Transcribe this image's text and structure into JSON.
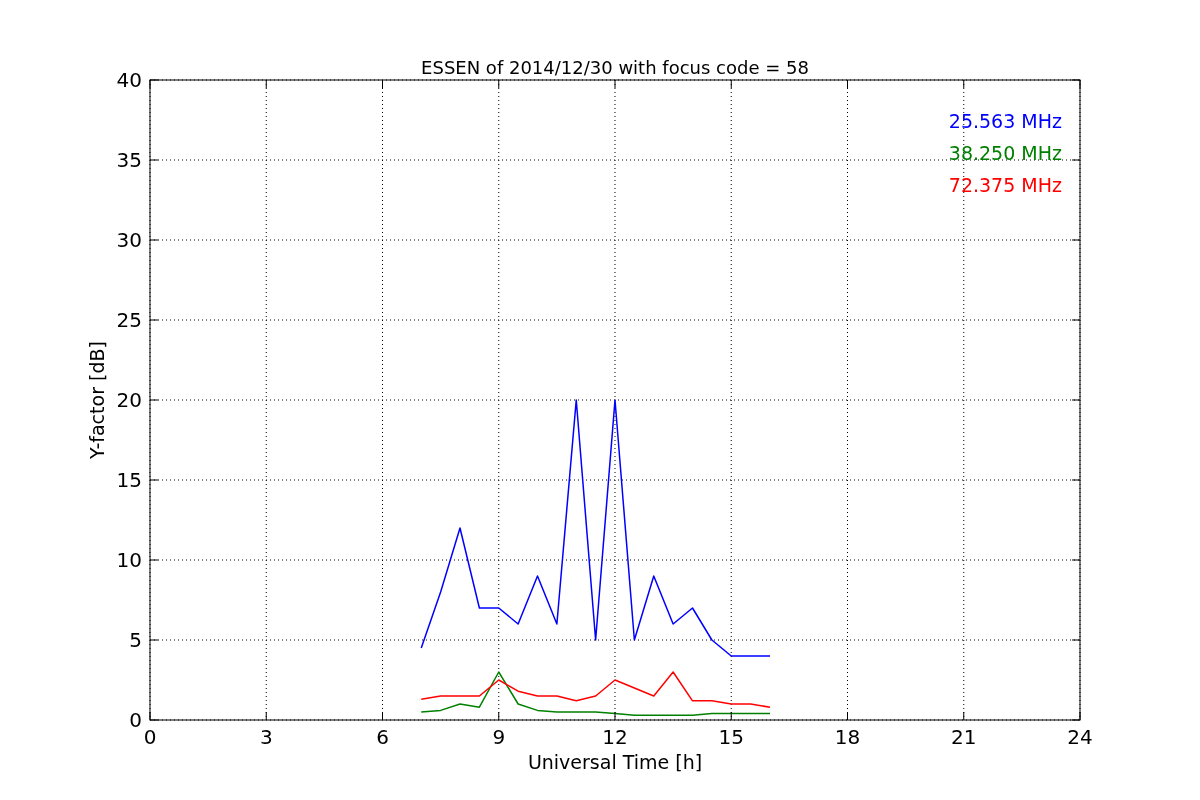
{
  "chart_data": {
    "type": "line",
    "title": "ESSEN of 2014/12/30 with focus code = 58",
    "xlabel": "Universal Time [h]",
    "ylabel": "Y-factor [dB]",
    "x": [
      7,
      7.5,
      8,
      8.5,
      9,
      9.5,
      10,
      10.5,
      11,
      11.5,
      12,
      12.5,
      13,
      13.5,
      14,
      14.5,
      15,
      15.5,
      16
    ],
    "series": [
      {
        "name": "25.563 MHz",
        "color": "#0000ff",
        "values": [
          4.5,
          8,
          12,
          7,
          7,
          6,
          9,
          6,
          20,
          5,
          20,
          5,
          9,
          6,
          7,
          5,
          4,
          4,
          4
        ]
      },
      {
        "name": "38.250 MHz",
        "color": "#008000",
        "values": [
          0.5,
          0.6,
          1,
          0.8,
          3,
          1,
          0.6,
          0.5,
          0.5,
          0.5,
          0.4,
          0.3,
          0.3,
          0.3,
          0.3,
          0.4,
          0.4,
          0.4,
          0.4
        ]
      },
      {
        "name": "72.375 MHz",
        "color": "#ff0000",
        "values": [
          1.3,
          1.5,
          1.5,
          1.5,
          2.5,
          1.8,
          1.5,
          1.5,
          1.2,
          1.5,
          2.5,
          2,
          1.5,
          3,
          1.2,
          1.2,
          1,
          1,
          0.8
        ]
      }
    ],
    "xlim": [
      0,
      24
    ],
    "ylim": [
      0,
      40
    ],
    "xticks": [
      0,
      3,
      6,
      9,
      12,
      15,
      18,
      21,
      24
    ],
    "yticks": [
      0,
      5,
      10,
      15,
      20,
      25,
      30,
      35,
      40
    ],
    "grid": true
  }
}
